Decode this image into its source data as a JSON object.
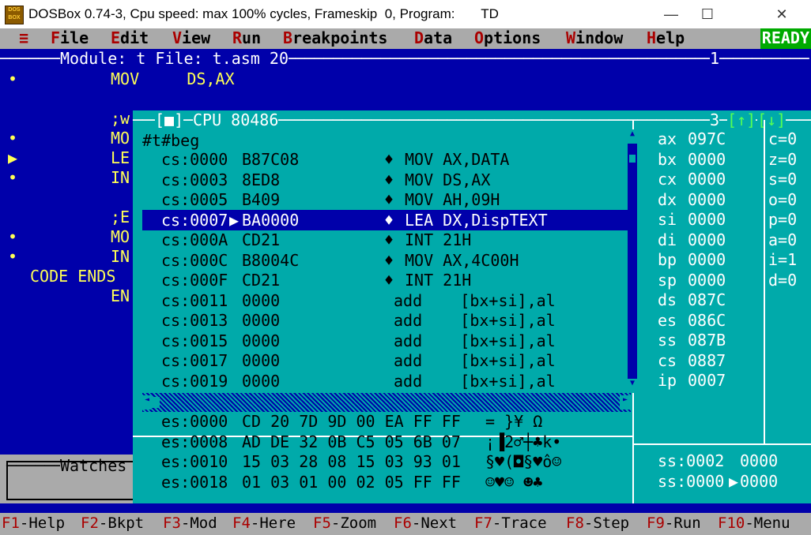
{
  "window": {
    "title": "DOSBox 0.74-3, Cpu speed: max 100% cycles, Frameskip  0, Program:       TD",
    "icon_text": "DOS BOX",
    "minimize": "—",
    "maximize": "☐",
    "close": "✕"
  },
  "menu": {
    "system": "≡",
    "items": [
      {
        "hk": "F",
        "rest": "ile"
      },
      {
        "hk": "E",
        "rest": "dit"
      },
      {
        "hk": "V",
        "rest": "iew"
      },
      {
        "hk": "R",
        "rest": "un"
      },
      {
        "hk": "B",
        "rest": "reakpoints"
      },
      {
        "hk": "D",
        "rest": "ata"
      },
      {
        "hk": "O",
        "rest": "ptions"
      },
      {
        "hk": "W",
        "rest": "indow"
      },
      {
        "hk": "H",
        "rest": "elp"
      }
    ],
    "status": "READY"
  },
  "module": {
    "title": "Module: t File: t.asm 20",
    "window_number": "1",
    "lines": [
      {
        "mark": "•",
        "text": "MOV     DS,AX"
      },
      {
        "mark": "",
        "text": ""
      },
      {
        "mark": "",
        "text": ";w"
      },
      {
        "mark": "•",
        "text": "MO"
      },
      {
        "mark": "▶",
        "text": "LE"
      },
      {
        "mark": "•",
        "text": "IN"
      },
      {
        "mark": "",
        "text": ""
      },
      {
        "mark": "",
        "text": ";E"
      },
      {
        "mark": "•",
        "text": "MO"
      },
      {
        "mark": "•",
        "text": "IN"
      },
      {
        "mark": "",
        "text": "CODE ENDS"
      },
      {
        "mark": "",
        "text": "EN"
      }
    ]
  },
  "watches": {
    "title": "Watches"
  },
  "cpu": {
    "title": "CPU 80486",
    "close_box": "[■]",
    "window_number": "3",
    "zoom_up": "[↑]",
    "zoom_down": "[↓]",
    "label": "#t#beg",
    "code": [
      {
        "addr": "cs:0000",
        "bytes": "B87C08",
        "mark": "♦",
        "instr": "MOV AX,DATA"
      },
      {
        "addr": "cs:0003",
        "bytes": "8ED8",
        "mark": "♦",
        "instr": "MOV DS,AX"
      },
      {
        "addr": "cs:0005",
        "bytes": "B409",
        "mark": "♦",
        "instr": "MOV AH,09H"
      },
      {
        "addr": "cs:0007",
        "bytes": "BA0000",
        "mark": "♦",
        "instr": "LEA DX,DispTEXT",
        "current": true
      },
      {
        "addr": "cs:000A",
        "bytes": "CD21",
        "mark": "♦",
        "instr": "INT 21H"
      },
      {
        "addr": "cs:000C",
        "bytes": "B8004C",
        "mark": "♦",
        "instr": "MOV AX,4C00H"
      },
      {
        "addr": "cs:000F",
        "bytes": "CD21",
        "mark": "♦",
        "instr": "INT 21H"
      },
      {
        "addr": "cs:0011",
        "bytes": "0000",
        "mark": "",
        "instr": "add    [bx+si],al"
      },
      {
        "addr": "cs:0013",
        "bytes": "0000",
        "mark": "",
        "instr": "add    [bx+si],al"
      },
      {
        "addr": "cs:0015",
        "bytes": "0000",
        "mark": "",
        "instr": "add    [bx+si],al"
      },
      {
        "addr": "cs:0017",
        "bytes": "0000",
        "mark": "",
        "instr": "add    [bx+si],al"
      },
      {
        "addr": "cs:0019",
        "bytes": "0000",
        "mark": "",
        "instr": "add    [bx+si],al"
      }
    ],
    "registers": [
      {
        "name": "ax",
        "value": "097C"
      },
      {
        "name": "bx",
        "value": "0000"
      },
      {
        "name": "cx",
        "value": "0000"
      },
      {
        "name": "dx",
        "value": "0000"
      },
      {
        "name": "si",
        "value": "0000"
      },
      {
        "name": "di",
        "value": "0000"
      },
      {
        "name": "bp",
        "value": "0000"
      },
      {
        "name": "sp",
        "value": "0000"
      },
      {
        "name": "ds",
        "value": "087C"
      },
      {
        "name": "es",
        "value": "086C"
      },
      {
        "name": "ss",
        "value": "087B"
      },
      {
        "name": "cs",
        "value": "0887"
      },
      {
        "name": "ip",
        "value": "0007"
      }
    ],
    "flags": [
      "c=0",
      "z=0",
      "s=0",
      "o=0",
      "p=0",
      "a=0",
      "i=1",
      "d=0"
    ],
    "dump": [
      {
        "addr": "es:0000",
        "bytes": "CD 20 7D 9D 00 EA FF FF",
        "ascii": "= }¥ Ω"
      },
      {
        "addr": "es:0008",
        "bytes": "AD DE 32 0B C5 05 6B 07",
        "ascii": "¡▐2♂┼♣k•"
      },
      {
        "addr": "es:0010",
        "bytes": "15 03 28 08 15 03 93 01",
        "ascii": "§♥(◘§♥ô☺"
      },
      {
        "addr": "es:0018",
        "bytes": "01 03 01 00 02 05 FF FF",
        "ascii": "☺♥☺ ☻♣"
      }
    ],
    "stack": [
      {
        "addr": "ss:0002",
        "value": "0000",
        "current": false
      },
      {
        "addr": "ss:0000",
        "value": "0000",
        "current": true
      }
    ]
  },
  "status_bar": [
    {
      "key": "F1",
      "label": "-Help"
    },
    {
      "key": "F2",
      "label": "-Bkpt"
    },
    {
      "key": "F3",
      "label": "-Mod"
    },
    {
      "key": "F4",
      "label": "-Here"
    },
    {
      "key": "F5",
      "label": "-Zoom"
    },
    {
      "key": "F6",
      "label": "-Next"
    },
    {
      "key": "F7",
      "label": "-Trace"
    },
    {
      "key": "F8",
      "label": "-Step"
    },
    {
      "key": "F9",
      "label": "-Run"
    },
    {
      "key": "F10",
      "label": "-Menu"
    }
  ]
}
